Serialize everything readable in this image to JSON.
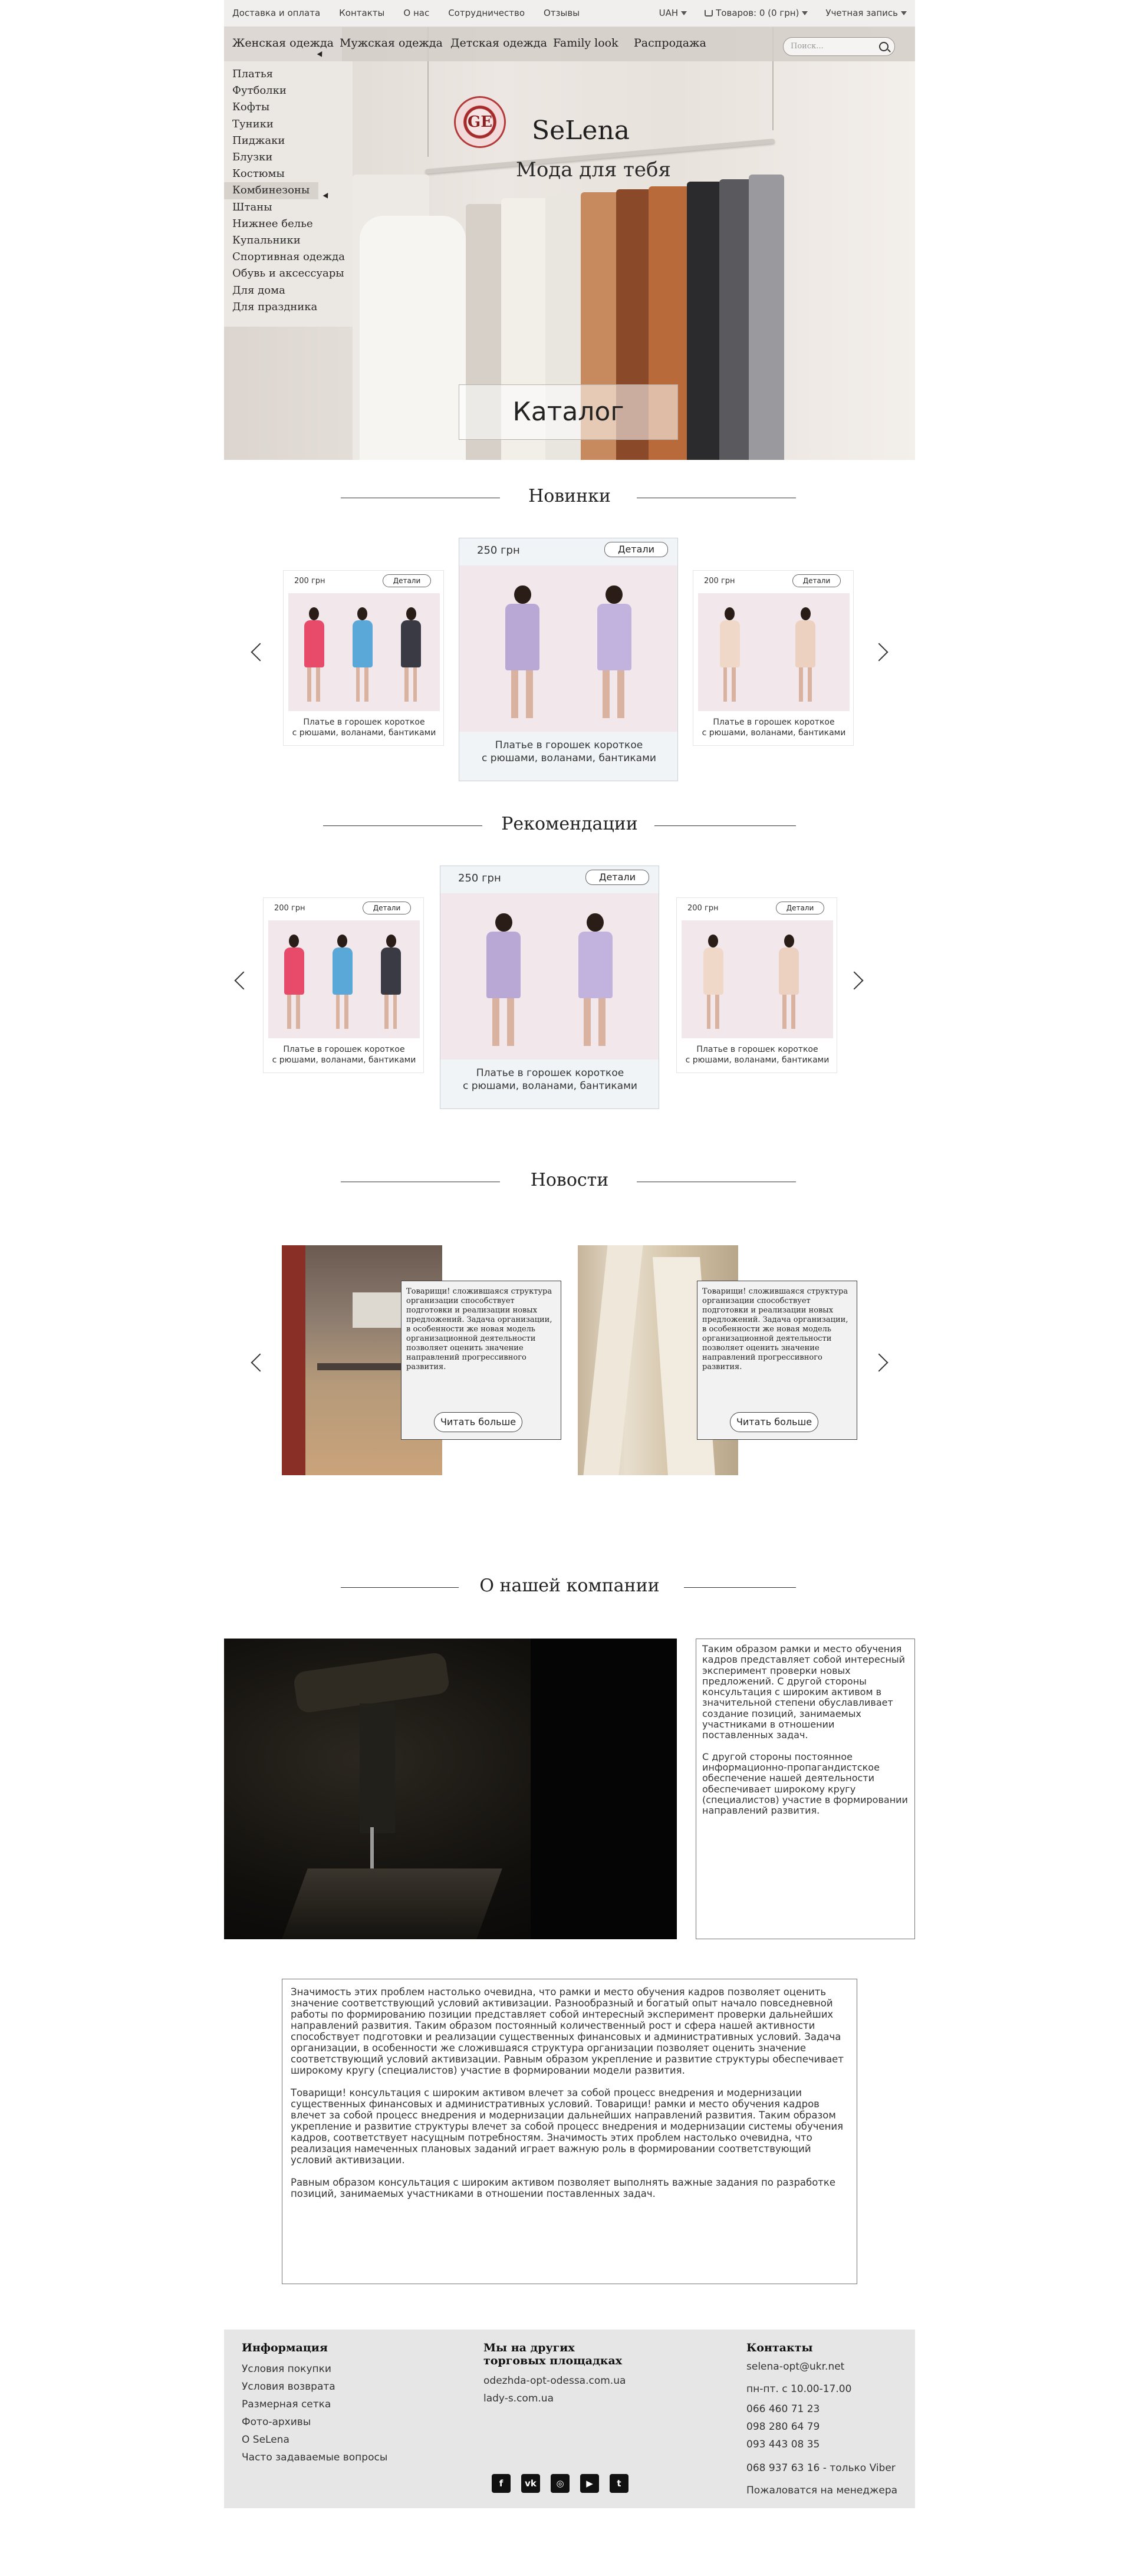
{
  "topbar": {
    "links": [
      "Доставка и оплата",
      "Контакты",
      "О нас",
      "Сотрудничество",
      "Отзывы"
    ],
    "currency": "UAH",
    "cart": "Товаров: 0 (0 грн)",
    "account": "Учетная запись"
  },
  "nav": {
    "items": [
      "Женская одежда",
      "Мужская одежда",
      "Детская одежда",
      "Family look",
      "Распродажа"
    ],
    "search_placeholder": "Поиск..."
  },
  "dropdown": {
    "items": [
      "Платья",
      "Футболки",
      "Кофты",
      "Туники",
      "Пиджаки",
      "Блузки",
      "Костюмы",
      "Комбинезоны",
      "Штаны",
      "Нижнее белье",
      "Купальники",
      "Спортивная одежда",
      "Обувь и аксессуары",
      "Для дома",
      "Для праздника"
    ]
  },
  "hero": {
    "logo_text": "GE",
    "brand": "SeLena",
    "tagline": "Мода для тебя",
    "catalog_button": "Каталог"
  },
  "sections": {
    "new": "Новинки",
    "recommend": "Рекомендации",
    "news": "Новости",
    "about": "О нашей компании"
  },
  "products": {
    "small_price": "200 грн",
    "big_price": "250 грн",
    "details": "Детали",
    "caption_line1": "Платье в горошек короткое",
    "caption_line2": "с рюшами, воланами, бантиками"
  },
  "news": {
    "text": "Товарищи! сложившаяся структура организации способствует подготовки и реализации новых предложений. Задача организации, в особенности же новая модель организационной деятельности позволяет оценить значение направлений прогрессивного развития.",
    "more": "Читать больше"
  },
  "about": {
    "side_p1": "Таким образом рамки и место обучения кадров представляет собой интересный эксперимент проверки новых предложений. С другой стороны консультация с широким активом в значительной степени обуславливает создание позиций, занимаемых участниками в отношении поставленных задач.",
    "side_p2": "С другой стороны постоянное информационно-пропагандистское обеспечение нашей деятельности обеспечивает широкому кругу (специалистов) участие в формировании направлений развития.",
    "long_p1": "Значимость этих проблем настолько очевидна, что рамки и место обучения кадров позволяет оценить значение соответствующий условий активизации. Разнообразный и богатый опыт начало повседневной работы по формированию позиции представляет собой интересный эксперимент проверки дальнейших направлений развития. Таким образом постоянный количественный рост и сфера нашей активности способствует подготовки и реализации существенных финансовых и административных условий. Задача организации, в особенности же сложившаяся структура организации позволяет оценить значение соответствующий условий активизации. Равным образом укрепление и развитие структуры обеспечивает широкому кругу (специалистов) участие в формировании модели развития.",
    "long_p2": "Товарищи! консультация с широким активом влечет за собой процесс внедрения и модернизации существенных финансовых и административных условий. Товарищи! рамки и место обучения кадров влечет за собой процесс внедрения и модернизации дальнейших направлений развития. Таким образом укрепление и развитие структуры влечет за собой процесс внедрения и модернизации системы обучения кадров, соответствует насущным потребностям. Значимость этих проблем настолько очевидна, что реализация намеченных плановых заданий играет важную роль в формировании соответствующий условий активизации.",
    "long_p3": "Равным образом консультация с широким активом позволяет выполнять важные задания по разработке позиций, занимаемых участниками в отношении поставленных задач."
  },
  "footer": {
    "info_title": "Информация",
    "info_items": [
      "Условия покупки",
      "Условия возврата",
      "Размерная сетка",
      "Фото-архивы",
      "О SeLena",
      "Часто задаваемые вопросы"
    ],
    "markets_title_1": "Мы на других",
    "markets_title_2": "торговых площадках",
    "markets": [
      "odezhda-opt-odessa.com.ua",
      "lady-s.com.ua"
    ],
    "contacts_title": "Контакты",
    "email": "selena-opt@ukr.net",
    "hours": "пн-пт. с 10.00-17.00",
    "phones": [
      "066 460 71 23",
      "098 280 64 79",
      "093 443 08 35"
    ],
    "viber": "068 937 63 16 - только Viber",
    "manager": "Пожаловатся на менеджера",
    "social": [
      "facebook-icon",
      "vk-icon",
      "instagram-icon",
      "youtube-icon",
      "twitter-icon"
    ]
  }
}
